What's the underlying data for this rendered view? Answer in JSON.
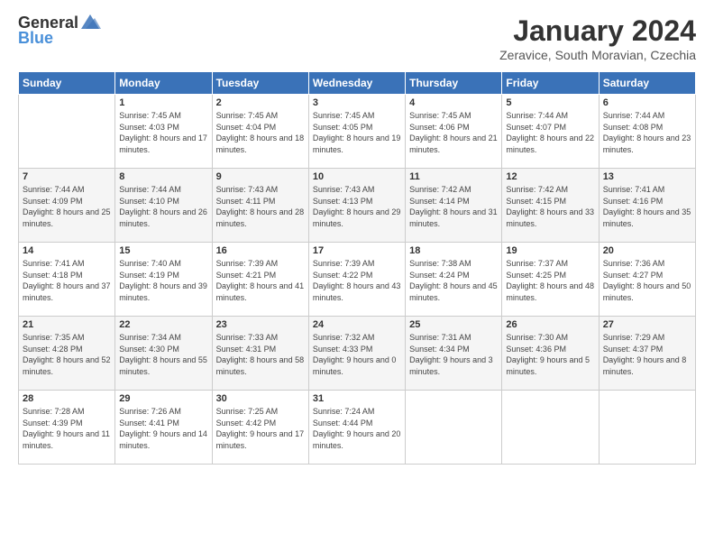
{
  "header": {
    "logo_general": "General",
    "logo_blue": "Blue",
    "title": "January 2024",
    "location": "Zeravice, South Moravian, Czechia"
  },
  "days_of_week": [
    "Sunday",
    "Monday",
    "Tuesday",
    "Wednesday",
    "Thursday",
    "Friday",
    "Saturday"
  ],
  "weeks": [
    [
      {
        "day": "",
        "sunrise": "",
        "sunset": "",
        "daylight": ""
      },
      {
        "day": "1",
        "sunrise": "Sunrise: 7:45 AM",
        "sunset": "Sunset: 4:03 PM",
        "daylight": "Daylight: 8 hours and 17 minutes."
      },
      {
        "day": "2",
        "sunrise": "Sunrise: 7:45 AM",
        "sunset": "Sunset: 4:04 PM",
        "daylight": "Daylight: 8 hours and 18 minutes."
      },
      {
        "day": "3",
        "sunrise": "Sunrise: 7:45 AM",
        "sunset": "Sunset: 4:05 PM",
        "daylight": "Daylight: 8 hours and 19 minutes."
      },
      {
        "day": "4",
        "sunrise": "Sunrise: 7:45 AM",
        "sunset": "Sunset: 4:06 PM",
        "daylight": "Daylight: 8 hours and 21 minutes."
      },
      {
        "day": "5",
        "sunrise": "Sunrise: 7:44 AM",
        "sunset": "Sunset: 4:07 PM",
        "daylight": "Daylight: 8 hours and 22 minutes."
      },
      {
        "day": "6",
        "sunrise": "Sunrise: 7:44 AM",
        "sunset": "Sunset: 4:08 PM",
        "daylight": "Daylight: 8 hours and 23 minutes."
      }
    ],
    [
      {
        "day": "7",
        "sunrise": "Sunrise: 7:44 AM",
        "sunset": "Sunset: 4:09 PM",
        "daylight": "Daylight: 8 hours and 25 minutes."
      },
      {
        "day": "8",
        "sunrise": "Sunrise: 7:44 AM",
        "sunset": "Sunset: 4:10 PM",
        "daylight": "Daylight: 8 hours and 26 minutes."
      },
      {
        "day": "9",
        "sunrise": "Sunrise: 7:43 AM",
        "sunset": "Sunset: 4:11 PM",
        "daylight": "Daylight: 8 hours and 28 minutes."
      },
      {
        "day": "10",
        "sunrise": "Sunrise: 7:43 AM",
        "sunset": "Sunset: 4:13 PM",
        "daylight": "Daylight: 8 hours and 29 minutes."
      },
      {
        "day": "11",
        "sunrise": "Sunrise: 7:42 AM",
        "sunset": "Sunset: 4:14 PM",
        "daylight": "Daylight: 8 hours and 31 minutes."
      },
      {
        "day": "12",
        "sunrise": "Sunrise: 7:42 AM",
        "sunset": "Sunset: 4:15 PM",
        "daylight": "Daylight: 8 hours and 33 minutes."
      },
      {
        "day": "13",
        "sunrise": "Sunrise: 7:41 AM",
        "sunset": "Sunset: 4:16 PM",
        "daylight": "Daylight: 8 hours and 35 minutes."
      }
    ],
    [
      {
        "day": "14",
        "sunrise": "Sunrise: 7:41 AM",
        "sunset": "Sunset: 4:18 PM",
        "daylight": "Daylight: 8 hours and 37 minutes."
      },
      {
        "day": "15",
        "sunrise": "Sunrise: 7:40 AM",
        "sunset": "Sunset: 4:19 PM",
        "daylight": "Daylight: 8 hours and 39 minutes."
      },
      {
        "day": "16",
        "sunrise": "Sunrise: 7:39 AM",
        "sunset": "Sunset: 4:21 PM",
        "daylight": "Daylight: 8 hours and 41 minutes."
      },
      {
        "day": "17",
        "sunrise": "Sunrise: 7:39 AM",
        "sunset": "Sunset: 4:22 PM",
        "daylight": "Daylight: 8 hours and 43 minutes."
      },
      {
        "day": "18",
        "sunrise": "Sunrise: 7:38 AM",
        "sunset": "Sunset: 4:24 PM",
        "daylight": "Daylight: 8 hours and 45 minutes."
      },
      {
        "day": "19",
        "sunrise": "Sunrise: 7:37 AM",
        "sunset": "Sunset: 4:25 PM",
        "daylight": "Daylight: 8 hours and 48 minutes."
      },
      {
        "day": "20",
        "sunrise": "Sunrise: 7:36 AM",
        "sunset": "Sunset: 4:27 PM",
        "daylight": "Daylight: 8 hours and 50 minutes."
      }
    ],
    [
      {
        "day": "21",
        "sunrise": "Sunrise: 7:35 AM",
        "sunset": "Sunset: 4:28 PM",
        "daylight": "Daylight: 8 hours and 52 minutes."
      },
      {
        "day": "22",
        "sunrise": "Sunrise: 7:34 AM",
        "sunset": "Sunset: 4:30 PM",
        "daylight": "Daylight: 8 hours and 55 minutes."
      },
      {
        "day": "23",
        "sunrise": "Sunrise: 7:33 AM",
        "sunset": "Sunset: 4:31 PM",
        "daylight": "Daylight: 8 hours and 58 minutes."
      },
      {
        "day": "24",
        "sunrise": "Sunrise: 7:32 AM",
        "sunset": "Sunset: 4:33 PM",
        "daylight": "Daylight: 9 hours and 0 minutes."
      },
      {
        "day": "25",
        "sunrise": "Sunrise: 7:31 AM",
        "sunset": "Sunset: 4:34 PM",
        "daylight": "Daylight: 9 hours and 3 minutes."
      },
      {
        "day": "26",
        "sunrise": "Sunrise: 7:30 AM",
        "sunset": "Sunset: 4:36 PM",
        "daylight": "Daylight: 9 hours and 5 minutes."
      },
      {
        "day": "27",
        "sunrise": "Sunrise: 7:29 AM",
        "sunset": "Sunset: 4:37 PM",
        "daylight": "Daylight: 9 hours and 8 minutes."
      }
    ],
    [
      {
        "day": "28",
        "sunrise": "Sunrise: 7:28 AM",
        "sunset": "Sunset: 4:39 PM",
        "daylight": "Daylight: 9 hours and 11 minutes."
      },
      {
        "day": "29",
        "sunrise": "Sunrise: 7:26 AM",
        "sunset": "Sunset: 4:41 PM",
        "daylight": "Daylight: 9 hours and 14 minutes."
      },
      {
        "day": "30",
        "sunrise": "Sunrise: 7:25 AM",
        "sunset": "Sunset: 4:42 PM",
        "daylight": "Daylight: 9 hours and 17 minutes."
      },
      {
        "day": "31",
        "sunrise": "Sunrise: 7:24 AM",
        "sunset": "Sunset: 4:44 PM",
        "daylight": "Daylight: 9 hours and 20 minutes."
      },
      {
        "day": "",
        "sunrise": "",
        "sunset": "",
        "daylight": ""
      },
      {
        "day": "",
        "sunrise": "",
        "sunset": "",
        "daylight": ""
      },
      {
        "day": "",
        "sunrise": "",
        "sunset": "",
        "daylight": ""
      }
    ]
  ]
}
